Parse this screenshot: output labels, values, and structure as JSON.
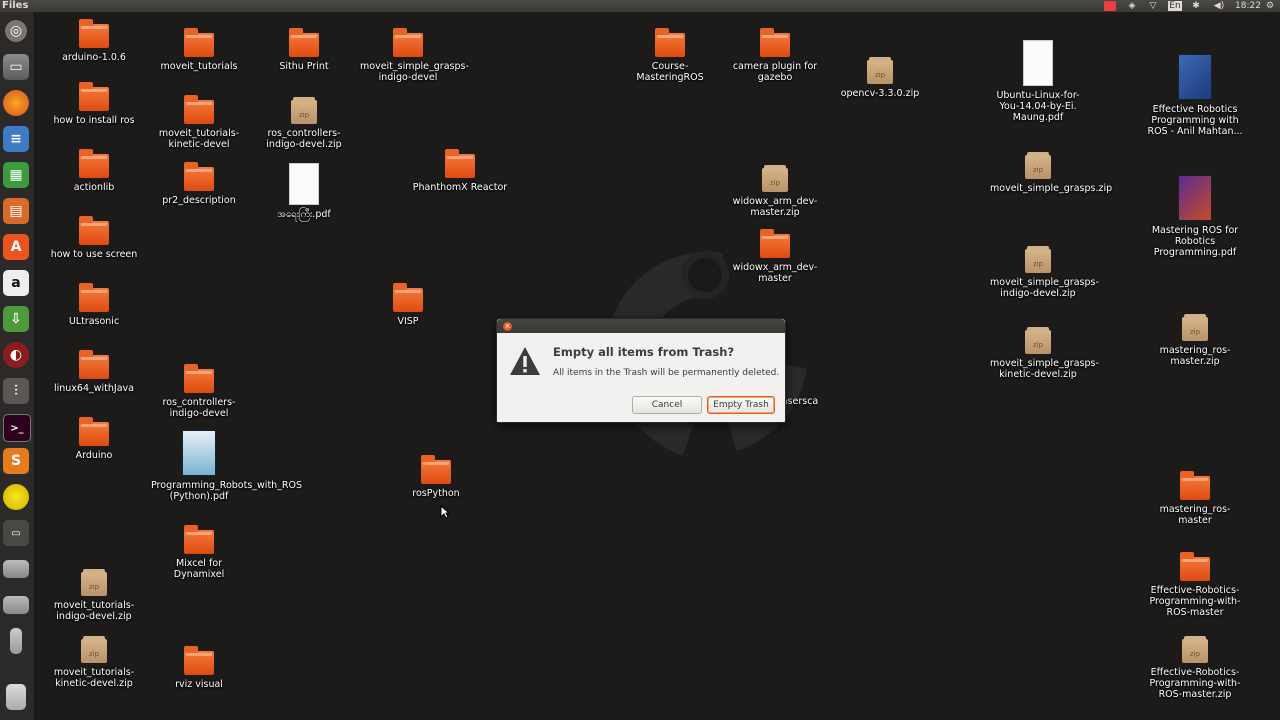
{
  "topbar": {
    "app_title": "Files",
    "keyboard_layout": "En",
    "time": "18:22",
    "indicators": [
      "stop-recording-icon",
      "dropbox-icon",
      "network-wifi-icon",
      "keyboard-icon",
      "bluetooth-icon",
      "volume-icon",
      "session-gear-icon"
    ]
  },
  "launcher": {
    "items": [
      "ubuntu-dash-icon",
      "files-icon",
      "firefox-icon",
      "writer-icon",
      "calc-icon",
      "impress-icon",
      "software-center-icon",
      "amazon-icon",
      "update-manager-icon",
      "system-monitor-icon",
      "settings-icon",
      "terminal-icon",
      "sublime-text-icon",
      "app-yellow-icon",
      "window-icon",
      "drive-icon",
      "drive-icon-2",
      "usb-drive-icon",
      "trash-icon"
    ]
  },
  "desktop": {
    "items": [
      {
        "label": "arduino-1.0.6",
        "type": "folder"
      },
      {
        "label": "how to install ros",
        "type": "folder"
      },
      {
        "label": "actionlib",
        "type": "folder"
      },
      {
        "label": "how to use screen",
        "type": "folder"
      },
      {
        "label": "ULtrasonic",
        "type": "folder"
      },
      {
        "label": "linux64_withJava",
        "type": "folder"
      },
      {
        "label": "Arduino",
        "type": "folder"
      },
      {
        "label": "moveit_tutorials-indigo-devel.zip",
        "type": "zip"
      },
      {
        "label": "moveit_tutorials-kinetic-devel.zip",
        "type": "zip"
      },
      {
        "label": "moveit_tutorials",
        "type": "folder"
      },
      {
        "label": "moveit_tutorials-kinetic-devel",
        "type": "folder"
      },
      {
        "label": "pr2_description",
        "type": "folder"
      },
      {
        "label": "ros_controllers-indigo-devel",
        "type": "folder"
      },
      {
        "label": "Programming_Robots_with_ROS (Python).pdf",
        "type": "book"
      },
      {
        "label": "Mixcel for Dynamixel",
        "type": "folder"
      },
      {
        "label": "rviz visual",
        "type": "folder"
      },
      {
        "label": "Sithu Print",
        "type": "folder"
      },
      {
        "label": "ros_controllers-indigo-devel.zip",
        "type": "zip"
      },
      {
        "label": "အရေးကြီး.pdf",
        "type": "pdf"
      },
      {
        "label": "moveit_simple_grasps-indigo-devel",
        "type": "folder"
      },
      {
        "label": "VISP",
        "type": "folder"
      },
      {
        "label": "PhanthomX Reactor",
        "type": "folder"
      },
      {
        "label": "rosPython",
        "type": "folder"
      },
      {
        "label": "Course-MasteringROS",
        "type": "folder"
      },
      {
        "label": "camera plugin for gazebo",
        "type": "folder"
      },
      {
        "label": "widowx_arm_dev-master.zip",
        "type": "zip"
      },
      {
        "label": "widowx_arm_dev-master",
        "type": "folder"
      },
      {
        "label": "asersca",
        "type": "partial"
      },
      {
        "label": "opencv-3.3.0.zip",
        "type": "zip"
      },
      {
        "label": "Ubuntu-Linux-for-You-14.04-by-Ei. Maung.pdf",
        "type": "pdf"
      },
      {
        "label": "moveit_simple_grasps.zip",
        "type": "zip"
      },
      {
        "label": "moveit_simple_grasps-indigo-devel.zip",
        "type": "zip"
      },
      {
        "label": "moveit_simple_grasps-kinetic-devel.zip",
        "type": "zip"
      },
      {
        "label": "Effective Robotics Programming with ROS - Anil Mahtan...",
        "type": "book"
      },
      {
        "label": "Mastering ROS for Robotics Programming.pdf",
        "type": "book"
      },
      {
        "label": "mastering_ros-master.zip",
        "type": "zip"
      },
      {
        "label": "mastering_ros-master",
        "type": "folder"
      },
      {
        "label": "Effective-Robotics-Programming-with-ROS-master",
        "type": "folder"
      },
      {
        "label": "Effective-Robotics-Programming-with-ROS-master.zip",
        "type": "zip"
      }
    ]
  },
  "dialog": {
    "heading": "Empty all items from Trash?",
    "message": "All items in the Trash will be permanently deleted.",
    "cancel_label": "Cancel",
    "confirm_label": "Empty Trash",
    "close_glyph": "×",
    "warning_glyph": "!",
    "icon": "warning-icon"
  },
  "colors": {
    "accent": "#e95420",
    "folder": "#f07a3a",
    "desktop_bg": "#1c1b1a",
    "panel": "#3c3b37"
  }
}
